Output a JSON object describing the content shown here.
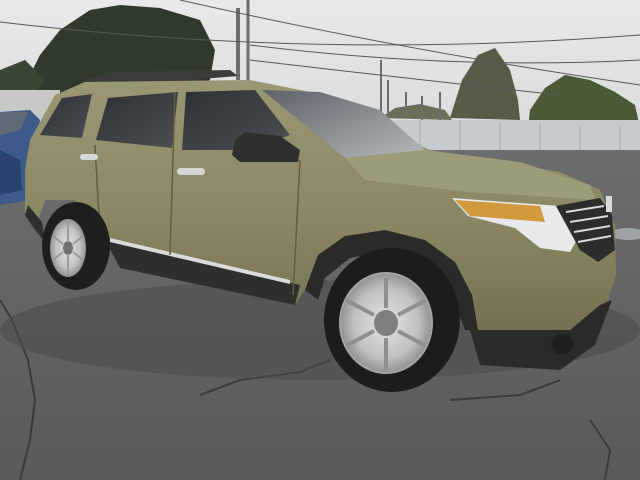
{
  "scene": {
    "subject": "SUV",
    "setting": "auction lot",
    "colors": {
      "sky": "#dfe1e3",
      "asphalt": "#5f6062",
      "body_paint": "#8c8a63",
      "fence": "#c9ced0",
      "wheel": "#c8cacc"
    }
  }
}
